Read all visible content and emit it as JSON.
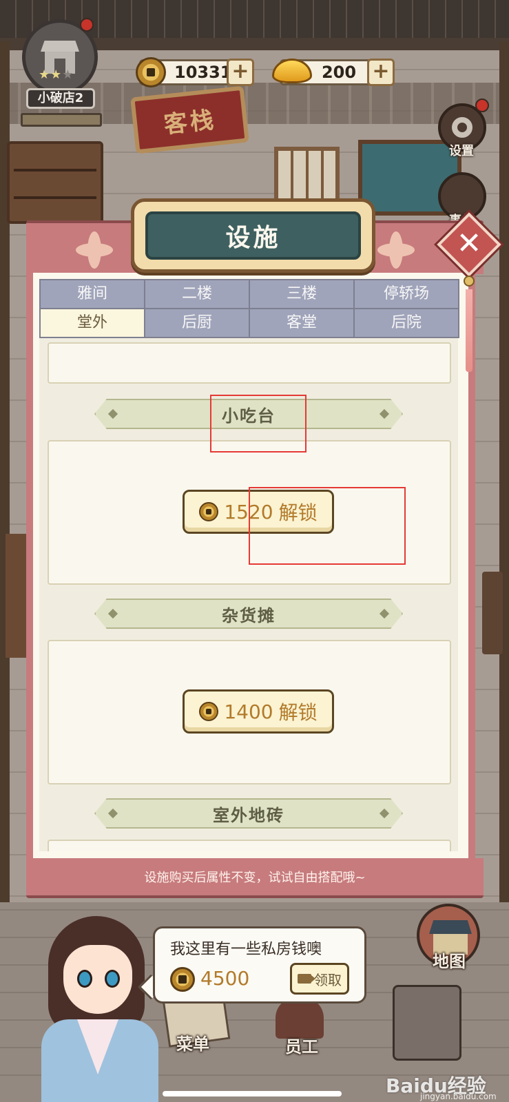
{
  "hud": {
    "shop_name": "小破店2",
    "stars_filled": 2,
    "stars_total": 3,
    "coins": "10331",
    "ingots": "200"
  },
  "background": {
    "inn_sign": "客栈"
  },
  "side_menu": {
    "settings_label": "设置",
    "events_label": "事件"
  },
  "panel": {
    "title": "设施",
    "tabs": [
      {
        "label": "雅间",
        "active": false
      },
      {
        "label": "二楼",
        "active": false
      },
      {
        "label": "三楼",
        "active": false
      },
      {
        "label": "停轿场",
        "active": false
      },
      {
        "label": "堂外",
        "active": true
      },
      {
        "label": "后厨",
        "active": false
      },
      {
        "label": "客堂",
        "active": false
      },
      {
        "label": "后院",
        "active": false
      }
    ],
    "sections": [
      {
        "title": "小吃台",
        "unlock_price": "1520",
        "unlock_text": "解锁"
      },
      {
        "title": "杂货摊",
        "unlock_price": "1400",
        "unlock_text": "解锁"
      },
      {
        "title": "室外地砖"
      }
    ],
    "footer_tip": "设施购买后属性不变，试试自由搭配哦~"
  },
  "npc_offer": {
    "message": "我这里有一些私房钱噢",
    "amount": "4500",
    "claim_label": "领取"
  },
  "bottom_nav": {
    "menu_label": "菜单",
    "staff_label": "员工",
    "map_label": "地图"
  },
  "watermark": {
    "brand": "Baidu经验",
    "site": "jingyan.baidu.com"
  },
  "colors": {
    "panel_frame": "#c77b7d",
    "title_plaque": "#3f6060",
    "tab_inactive": "#a0a4ba",
    "tab_active": "#fbf6de",
    "unlock_text": "#b27a2a",
    "annotation": "#e53935"
  }
}
